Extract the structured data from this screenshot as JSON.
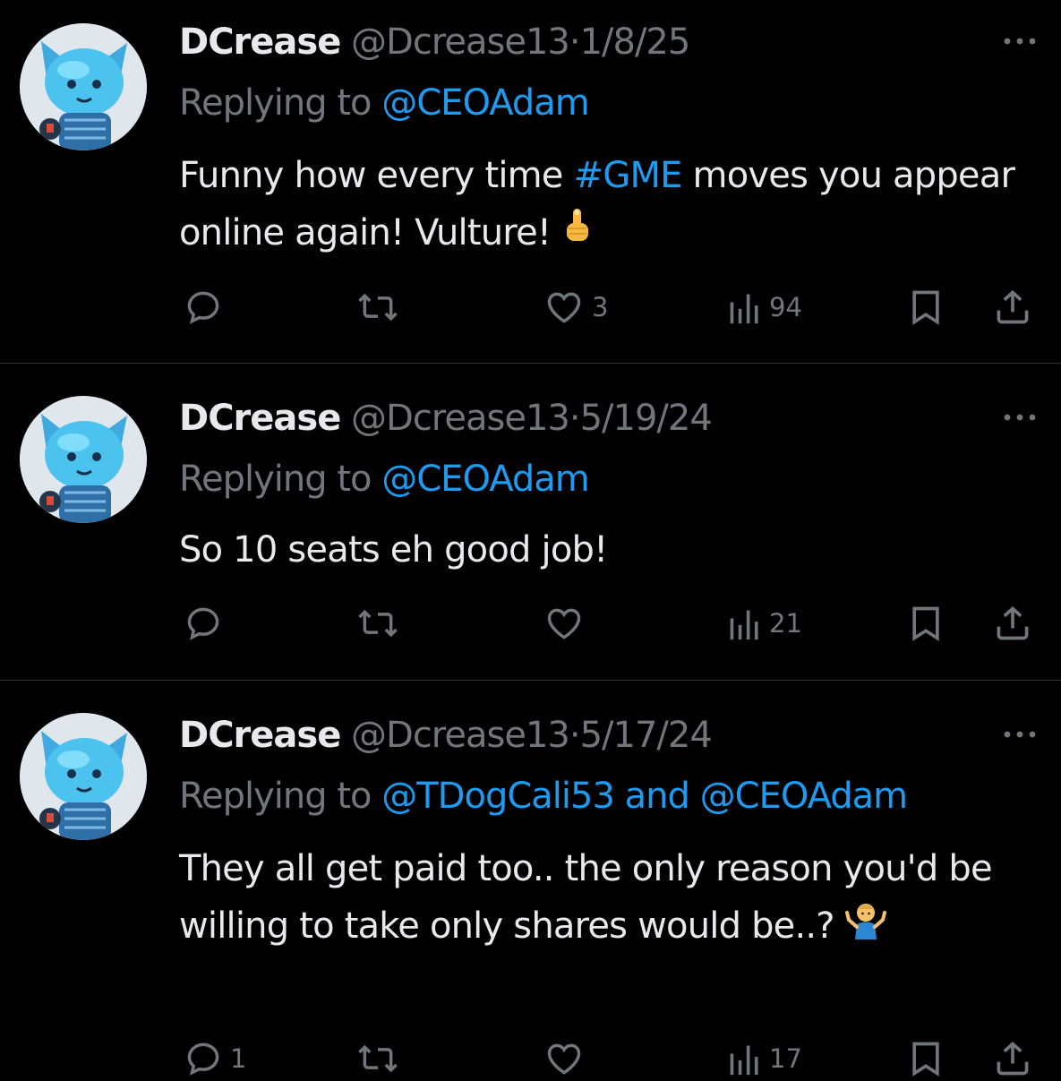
{
  "colors": {
    "background": "#000000",
    "text": "#e7e9ea",
    "muted": "#71767b",
    "link": "#1d9bf0",
    "divider": "#2f3336"
  },
  "tweets": [
    {
      "display_name": "DCrease",
      "handle": "@Dcrease13",
      "separator": "·",
      "date": "1/8/25",
      "replying_prefix": "Replying to",
      "mentions": [
        "@CEOAdam"
      ],
      "mention_joiner": "",
      "text_parts": [
        "Funny how every time ",
        "#GME",
        " moves you appear online again! Vulture!"
      ],
      "emoji": "middle-finger-emoji",
      "actions": {
        "replies": "",
        "reposts": "",
        "likes": "3",
        "views": "94"
      }
    },
    {
      "display_name": "DCrease",
      "handle": "@Dcrease13",
      "separator": "·",
      "date": "5/19/24",
      "replying_prefix": "Replying to",
      "mentions": [
        "@CEOAdam"
      ],
      "mention_joiner": "",
      "text": "So 10 seats eh good job!",
      "actions": {
        "replies": "",
        "reposts": "",
        "likes": "",
        "views": "21"
      }
    },
    {
      "display_name": "DCrease",
      "handle": "@Dcrease13",
      "separator": "·",
      "date": "5/17/24",
      "replying_prefix": "Replying to",
      "mentions": [
        "@TDogCali53",
        "@CEOAdam"
      ],
      "mention_joiner": "and",
      "text": "They all get paid too.. the only reason you'd be willing to take only shares would be..?",
      "emoji": "man-shrugging-emoji",
      "actions": {
        "replies": "1",
        "reposts": "",
        "likes": "",
        "views": "17"
      }
    }
  ]
}
